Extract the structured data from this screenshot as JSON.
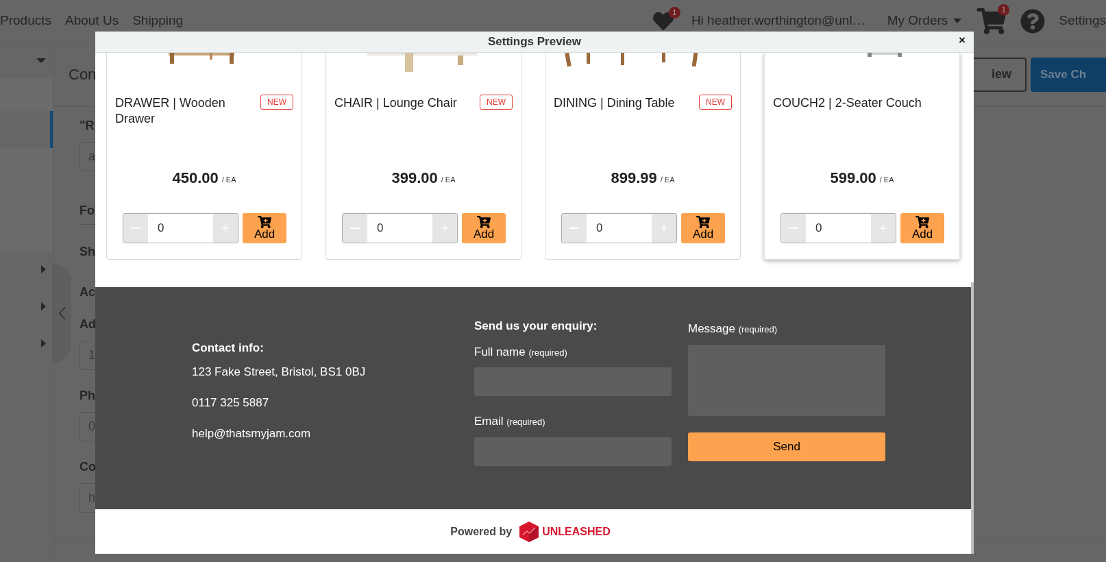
{
  "nav": {
    "links": [
      "Products",
      "About Us",
      "Shipping"
    ],
    "wishlist_badge": "1",
    "greeting": "Hi heather.worthington@unl…",
    "orders_menu": "My Orders",
    "cart_badge": "1",
    "settings": "Settings"
  },
  "page": {
    "sidebar": [
      {
        "selected": false
      },
      {
        "selected": true
      },
      {
        "selected": false
      }
    ],
    "heading": "Con",
    "buttons": [
      "iew",
      "Save Ch"
    ],
    "form": [
      {
        "kind": "field",
        "label": "\"R",
        "value": "a"
      },
      {
        "kind": "section",
        "label": "Fo"
      },
      {
        "kind": "label",
        "label": "Sh"
      },
      {
        "kind": "label",
        "label": "Ac"
      },
      {
        "kind": "field",
        "label": "Ad",
        "value": "1"
      },
      {
        "kind": "field",
        "label": "Ph",
        "value": "0"
      },
      {
        "kind": "field",
        "label": "Co",
        "value": "h"
      }
    ]
  },
  "modal": {
    "title": "Settings Preview",
    "close": "×",
    "products": [
      {
        "title": "DRAWER | Wooden Drawer",
        "badge": "NEW",
        "price": "450.00",
        "unit": "/ EA",
        "quantity": "0",
        "add": "Add",
        "highlighted": false
      },
      {
        "title": "CHAIR | Lounge Chair",
        "badge": "NEW",
        "price": "399.00",
        "unit": "/ EA",
        "quantity": "0",
        "add": "Add",
        "highlighted": false
      },
      {
        "title": "DINING | Dining Table",
        "badge": "NEW",
        "price": "899.99",
        "unit": "/ EA",
        "quantity": "0",
        "add": "Add",
        "highlighted": false
      },
      {
        "title": "COUCH2 | 2-Seater Couch",
        "price": "599.00",
        "unit": "/ EA",
        "quantity": "0",
        "add": "Add",
        "highlighted": true
      }
    ],
    "contact": {
      "heading": "Contact info:",
      "lines": [
        "123 Fake Street, Bristol, BS1 0BJ",
        "0117 325 5887",
        "help@thatsmyjam.com"
      ]
    },
    "enquiry": {
      "heading": "Send us your enquiry:",
      "fields": [
        {
          "label": "Full name",
          "note": "(required)"
        },
        {
          "label": "Email",
          "note": "(required)"
        }
      ],
      "message": {
        "label": "Message",
        "note": "(required)"
      },
      "send": "Send"
    },
    "powered_by": {
      "text": "Powered by",
      "brand": "UNLEASHED"
    }
  }
}
